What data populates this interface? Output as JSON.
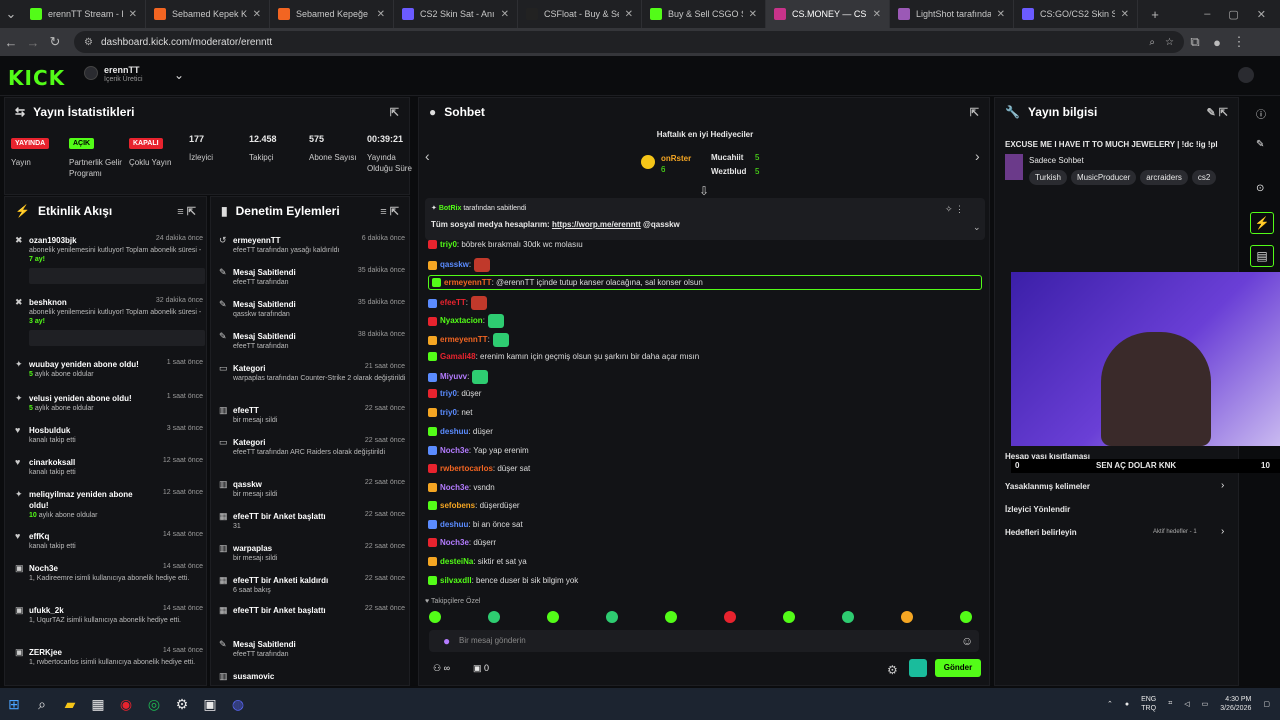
{
  "tabs": [
    {
      "label": "erennTT Stream - Kic",
      "color": "#53fc18",
      "active": false
    },
    {
      "label": "Sebamed Kepek Karşı",
      "color": "#f26522",
      "active": false
    },
    {
      "label": "Sebamed Kepeğe Karş",
      "color": "#f26522",
      "active": false
    },
    {
      "label": "CS2 Skin Sat - Anında",
      "color": "#6b5bff",
      "active": false
    },
    {
      "label": "CSFloat - Buy & Sell",
      "color": "#222",
      "active": false
    },
    {
      "label": "Buy & Sell CSGO Skin",
      "color": "#53fc18",
      "active": false
    },
    {
      "label": "CS.MONEY — CS:GO",
      "color": "#c8338a",
      "active": true
    },
    {
      "label": "LightShot tarafından",
      "color": "#9b59b6",
      "active": false
    },
    {
      "label": "CS:GO/CS2 Skin Satın",
      "color": "#6b5bff",
      "active": false
    }
  ],
  "url": "dashboard.kick.com/moderator/erenntt",
  "header": {
    "logo": "KICK",
    "channel": "erennTT",
    "role": "İçerik Üretici"
  },
  "stats": {
    "title": "Yayın İstatistikleri",
    "items": [
      {
        "badge": "YAYINDA",
        "badge_bg": "#e8232e",
        "label": "Yayın"
      },
      {
        "badge": "AÇIK",
        "badge_bg": "#53fc18",
        "label": "Partnerlik Gelir Programı"
      },
      {
        "badge": "KAPALI",
        "badge_bg": "#e8232e",
        "label": "Çoklu Yayın"
      },
      {
        "value": "177",
        "label": "İzleyici"
      },
      {
        "value": "12.458",
        "label": "Takipçi"
      },
      {
        "value": "575",
        "label": "Abone Sayısı"
      },
      {
        "value": "00:39:21",
        "label": "Yayında Olduğu Süre"
      }
    ]
  },
  "activity": {
    "title": "Etkinlik Akışı",
    "items": [
      {
        "title": "ozan1903bjk",
        "time": "24 dakika önce",
        "sub": "abonelik yenilemesini kutluyor! Toplam abonelik süresi - ",
        "hl": "7 ay!",
        "icon": "x"
      },
      {
        "title": "beshknon",
        "time": "32 dakika önce",
        "sub": "abonelik yenilemesini kutluyor! Toplam abonelik süresi - ",
        "hl": "3 ay!",
        "icon": "x"
      },
      {
        "title": "wuubay yeniden abone oldu!",
        "time": "1 saat önce",
        "sub": " aylık abone oldular",
        "hl": "5",
        "icon": "star"
      },
      {
        "title": "velusi yeniden abone oldu!",
        "time": "1 saat önce",
        "sub": " aylık abone oldular",
        "hl": "5",
        "icon": "star"
      },
      {
        "title": "Hosbulduk",
        "time": "3 saat önce",
        "sub": "kanalı takip etti",
        "hl": "",
        "icon": "heart"
      },
      {
        "title": "cinarkoksall",
        "time": "12 saat önce",
        "sub": "kanalı takip etti",
        "hl": "",
        "icon": "heart"
      },
      {
        "title": "meliqyilmaz yeniden abone oldu!",
        "time": "12 saat önce",
        "sub": " aylık abone oldular",
        "hl": "10",
        "icon": "star"
      },
      {
        "title": "effKq",
        "time": "14 saat önce",
        "sub": "kanalı takip etti",
        "hl": "",
        "icon": "heart"
      },
      {
        "title": "Noch3e",
        "time": "14 saat önce",
        "sub": "1, Kadireemre isimli kullanıcıya abonelik hediye etti.",
        "hl": "",
        "icon": "gift"
      },
      {
        "title": "ufukk_2k",
        "time": "14 saat önce",
        "sub": "1, UqurTAZ isimli kullanıcıya abonelik hediye etti.",
        "hl": "",
        "icon": "gift"
      },
      {
        "title": "ZERKjee",
        "time": "14 saat önce",
        "sub": "1, rwbertocarlos isimli kullanıcıya abonelik hediye etti.",
        "hl": "",
        "icon": "gift"
      }
    ]
  },
  "modlog": {
    "title": "Denetim Eylemleri",
    "items": [
      {
        "title": "ermeyennTT",
        "time": "6 dakika önce",
        "sub": "efeeTT tarafından yasağı kaldırıldı",
        "icon": "undo"
      },
      {
        "title": "Mesaj Sabitlendi",
        "time": "35 dakika önce",
        "sub": "efeeTT tarafından",
        "icon": "pin"
      },
      {
        "title": "Mesaj Sabitlendi",
        "time": "35 dakika önce",
        "sub": "qasskw tarafından",
        "icon": "pin"
      },
      {
        "title": "Mesaj Sabitlendi",
        "time": "38 dakika önce",
        "sub": "efeeTT tarafından",
        "icon": "pin"
      },
      {
        "title": "Kategori",
        "time": "21 saat önce",
        "sub": "warpaplas tarafından Counter-Strike 2 olarak değiştirildi",
        "icon": "cat"
      },
      {
        "title": "efeeTT",
        "time": "22 saat önce",
        "sub": "bir mesajı sildi",
        "icon": "trash"
      },
      {
        "title": "Kategori",
        "time": "22 saat önce",
        "sub": "efeeTT tarafından ARC Raiders olarak değiştirildi",
        "icon": "cat"
      },
      {
        "title": "qasskw",
        "time": "22 saat önce",
        "sub": "bir mesajı sildi",
        "icon": "trash"
      },
      {
        "title": "efeeTT bir Anket başlattı",
        "time": "22 saat önce",
        "sub": "31",
        "icon": "poll"
      },
      {
        "title": "warpaplas",
        "time": "22 saat önce",
        "sub": "bir mesajı sildi",
        "icon": "trash"
      },
      {
        "title": "efeeTT bir Anketi kaldırdı",
        "time": "22 saat önce",
        "sub": "6 saat bakış",
        "icon": "poll"
      },
      {
        "title": "efeeTT bir Anket başlattı",
        "time": "22 saat önce",
        "sub": "",
        "icon": "poll"
      },
      {
        "title": "Mesaj Sabitlendi",
        "time": "",
        "sub": "efeeTT tarafından",
        "icon": "pin"
      },
      {
        "title": "susamovic",
        "time": "",
        "sub": "",
        "icon": "trash"
      }
    ]
  },
  "chat": {
    "title": "Sohbet",
    "top_gifters_title": "Haftalık en iyi Hediyeciler",
    "gifters": [
      {
        "name": "onRster",
        "count": "6"
      },
      {
        "name": "Mucahiit",
        "count": "5"
      },
      {
        "name": "Weztblud",
        "count": "5"
      }
    ],
    "pinned_by": "BotRix",
    "pinned_by_suffix": "tarafından sabitlendi",
    "pinned_text": "Tüm sosyal medya hesaplarım: ",
    "pinned_link": "https://worp.me/erenntt",
    "pinned_mention": " @qasskw",
    "messages": [
      {
        "user": "triy0",
        "color": "#53fc18",
        "text": ": böbrek bırakmalı 30dk wc molasıu"
      },
      {
        "user": "qasskw",
        "color": "#5b8cff",
        "text": ":",
        "emote": "#c0392b"
      },
      {
        "user": "ermeyennTT",
        "color": "#f26522",
        "text": ": @erennTT içinde tutup kanser olacağına, sal konser olsun",
        "highlight": true
      },
      {
        "user": "efeeTT",
        "color": "#e8232e",
        "text": ":",
        "emote": "#c0392b"
      },
      {
        "user": "Nyaxtacion",
        "color": "#53fc18",
        "text": ":",
        "emote": "#2ecc71"
      },
      {
        "user": "ermeyennTT",
        "color": "#f26522",
        "text": ":",
        "emote": "#2ecc71"
      },
      {
        "user": "Gamali48",
        "color": "#e8232e",
        "text": ": erenim kamın için geçmiş olsun şu şarkını bir daha açar mısın"
      },
      {
        "user": "Miyuvv",
        "color": "#b47cff",
        "text": ":",
        "emote": "#2ecc71"
      },
      {
        "user": "triy0",
        "color": "#5b8cff",
        "text": ": düşer"
      },
      {
        "user": "triy0",
        "color": "#5b8cff",
        "text": ": net"
      },
      {
        "user": "deshuu",
        "color": "#5b8cff",
        "text": ": düşer"
      },
      {
        "user": "Noch3e",
        "color": "#b47cff",
        "text": ": Yap yap erenim"
      },
      {
        "user": "rwbertocarlos",
        "color": "#f26522",
        "text": ": düşer sat"
      },
      {
        "user": "Noch3e",
        "color": "#b47cff",
        "text": ": vsndn"
      },
      {
        "user": "sefobens",
        "color": "#f5a623",
        "text": ": düşerdüşer"
      },
      {
        "user": "deshuu",
        "color": "#5b8cff",
        "text": ": bi an önce sat"
      },
      {
        "user": "Noch3e",
        "color": "#b47cff",
        "text": ": düşerr"
      },
      {
        "user": "desteiNa",
        "color": "#53fc18",
        "text": ": siktir et sat ya"
      },
      {
        "user": "silvaxdll",
        "color": "#53fc18",
        "text": ": bence duser bi sik bilgim yok"
      }
    ],
    "emote_section": "Takipçilere Özel",
    "input_placeholder": "Bir mesaj gönderin",
    "send_label": "Gönder",
    "points": "∞",
    "gifts": "0"
  },
  "info": {
    "title": "Yayın bilgisi",
    "stream_title": "EXCUSE ME I HAVE IT TO MUCH JEWELERY | !dc !ig !pl",
    "category": "Sadece Sohbet",
    "tags": [
      "Turkish",
      "MusicProducer",
      "arcraiders",
      "cs2"
    ],
    "settings": [
      {
        "label": "Hesap yaşı kısıtlaması"
      },
      {
        "label": "Yasaklanmış kelimeler"
      },
      {
        "label": "İzleyici Yönlendir"
      },
      {
        "label": "Hedefleri belirleyin",
        "note": "Aktif hedefler - 1"
      }
    ],
    "overlay_text": "SEN AÇ DOLAR KNK",
    "overlay_left": "0",
    "overlay_right": "10"
  },
  "taskbar": {
    "lang": "ENG",
    "lang2": "TRQ",
    "time": "4:30 PM",
    "date": "3/26/2026"
  }
}
